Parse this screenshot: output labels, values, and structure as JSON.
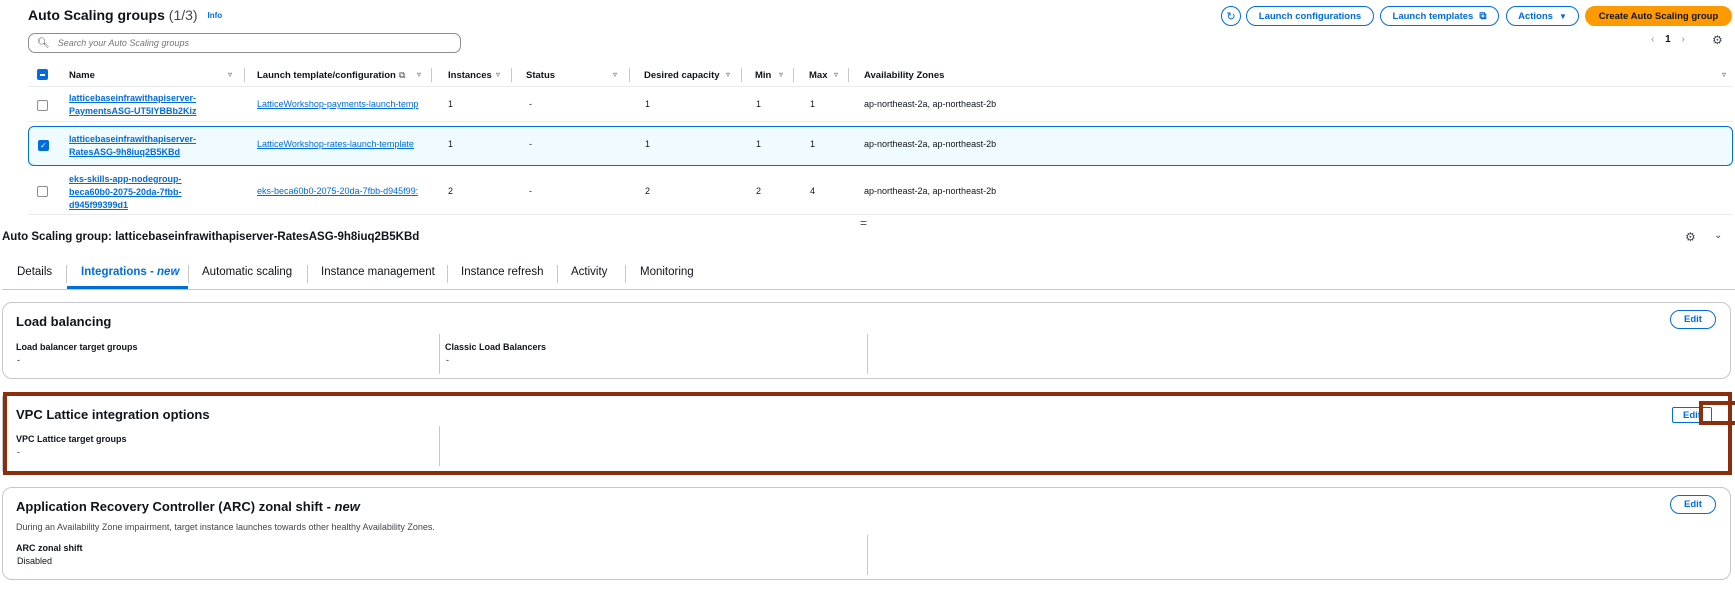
{
  "header": {
    "title": "Auto Scaling groups",
    "count": "(1/3)",
    "info": "Info",
    "buttons": {
      "launch_configurations": "Launch configurations",
      "launch_templates": "Launch templates",
      "actions": "Actions",
      "create": "Create Auto Scaling group"
    }
  },
  "search": {
    "placeholder": "Search your Auto Scaling groups"
  },
  "pager": {
    "page": "1"
  },
  "table": {
    "columns": [
      "Name",
      "Launch template/configuration",
      "Instances",
      "Status",
      "Desired capacity",
      "Min",
      "Max",
      "Availability Zones"
    ],
    "rows": [
      {
        "name_line1": "latticebaseinfrawithapiserver-",
        "name_line2": "PaymentsASG-UT5IYBBb2Kiz",
        "name_line3": "",
        "template": "LatticeWorkshop-payments-launch-temp",
        "instances": "1",
        "status": "-",
        "desired": "1",
        "min": "1",
        "max": "1",
        "azs": "ap-northeast-2a, ap-northeast-2b",
        "selected": false
      },
      {
        "name_line1": "latticebaseinfrawithapiserver-",
        "name_line2": "RatesASG-9h8iuq2B5KBd",
        "name_line3": "",
        "template": "LatticeWorkshop-rates-launch-template",
        "instances": "1",
        "status": "-",
        "desired": "1",
        "min": "1",
        "max": "1",
        "azs": "ap-northeast-2a, ap-northeast-2b",
        "selected": true
      },
      {
        "name_line1": "eks-skills-app-nodegroup-",
        "name_line2": "beca60b0-2075-20da-7fbb-",
        "name_line3": "d945f99399d1",
        "template": "eks-beca60b0-2075-20da-7fbb-d945f99:",
        "instances": "2",
        "status": "-",
        "desired": "2",
        "min": "2",
        "max": "4",
        "azs": "ap-northeast-2a, ap-northeast-2b",
        "selected": false
      }
    ]
  },
  "splitter": "=",
  "details": {
    "title": "Auto Scaling group: latticebaseinfrawithapiserver-RatesASG-9h8iuq2B5KBd",
    "tabs": [
      "Details",
      "Integrations - ",
      "Automatic scaling",
      "Instance management",
      "Instance refresh",
      "Activity",
      "Monitoring"
    ],
    "tab_new": "new"
  },
  "load_balancing": {
    "title": "Load balancing",
    "edit": "Edit",
    "target_groups_label": "Load balancer target groups",
    "target_groups_value": "-",
    "classic_label": "Classic Load Balancers",
    "classic_value": "-"
  },
  "vpc_lattice": {
    "title": "VPC Lattice integration options",
    "edit": "Edit",
    "target_groups_label": "VPC Lattice target groups",
    "target_groups_value": "-"
  },
  "arc": {
    "title": "Application Recovery Controller (ARC) zonal shift - ",
    "title_new": "new",
    "edit": "Edit",
    "description": "During an Availability Zone impairment, target instance launches towards other healthy Availability Zones.",
    "zonal_shift_label": "ARC zonal shift",
    "zonal_shift_value": "Disabled"
  },
  "colors": {
    "accent": "#006ce0",
    "primary_button": "#ff9900",
    "highlight_border": "#8b2e0e"
  }
}
